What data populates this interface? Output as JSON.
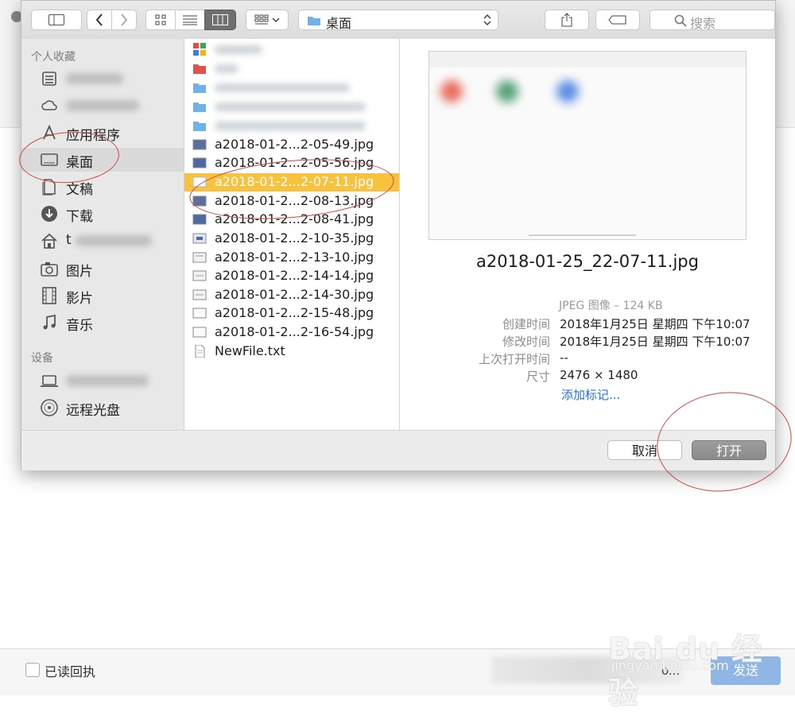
{
  "toolbar": {
    "location": "桌面",
    "search_placeholder": "搜索"
  },
  "sidebar": {
    "favorites_header": "个人收藏",
    "devices_header": "设备",
    "favorites": [
      {
        "label": "",
        "icon": "recents-icon"
      },
      {
        "label": "",
        "icon": "icloud-icon"
      },
      {
        "label": "应用程序",
        "icon": "applications-icon"
      },
      {
        "label": "桌面",
        "icon": "desktop-icon",
        "selected": true
      },
      {
        "label": "文稿",
        "icon": "documents-icon"
      },
      {
        "label": "下载",
        "icon": "downloads-icon"
      },
      {
        "label": "t",
        "icon": "home-icon"
      },
      {
        "label": "图片",
        "icon": "pictures-icon"
      },
      {
        "label": "影片",
        "icon": "movies-icon"
      },
      {
        "label": "音乐",
        "icon": "music-icon"
      }
    ],
    "devices": [
      {
        "label": "",
        "icon": "laptop-icon"
      },
      {
        "label": "远程光盘",
        "icon": "remote-disc-icon"
      }
    ]
  },
  "files": [
    {
      "name": "a2018-01-2...2-05-49.jpg",
      "icon": "image-file-icon"
    },
    {
      "name": "a2018-01-2...2-05-56.jpg",
      "icon": "image-file-icon"
    },
    {
      "name": "a2018-01-2...2-07-11.jpg",
      "icon": "image-file-icon",
      "selected": true
    },
    {
      "name": "a2018-01-2...2-08-13.jpg",
      "icon": "image-file-icon"
    },
    {
      "name": "a2018-01-2...2-08-41.jpg",
      "icon": "image-file-icon"
    },
    {
      "name": "a2018-01-2...2-10-35.jpg",
      "icon": "image-file-icon"
    },
    {
      "name": "a2018-01-2...2-13-10.jpg",
      "icon": "image-file-icon"
    },
    {
      "name": "a2018-01-2...2-14-14.jpg",
      "icon": "image-file-icon"
    },
    {
      "name": "a2018-01-2...2-14-30.jpg",
      "icon": "image-file-icon"
    },
    {
      "name": "a2018-01-2...2-15-48.jpg",
      "icon": "image-file-icon"
    },
    {
      "name": "a2018-01-2...2-16-54.jpg",
      "icon": "image-file-icon"
    },
    {
      "name": "NewFile.txt",
      "icon": "text-file-icon"
    }
  ],
  "preview": {
    "filename": "a2018-01-25_22-07-11.jpg",
    "kind": "JPEG 图像 – 124 KB",
    "created_label": "创建时间",
    "created_value": "2018年1月25日 星期四 下午10:07",
    "modified_label": "修改时间",
    "modified_value": "2018年1月25日 星期四 下午10:07",
    "last_opened_label": "上次打开时间",
    "last_opened_value": "--",
    "dimensions_label": "尺寸",
    "dimensions_value": "2476 × 1480",
    "add_tags": "添加标记..."
  },
  "footer": {
    "cancel_label": "取消",
    "open_label": "打开"
  },
  "background": {
    "read_receipt_label": "已读回执",
    "blurred_tail": "o...",
    "send_label": "发送"
  },
  "watermark": {
    "title": "Bai du 经验",
    "url": "jingyan.baidu.com"
  },
  "colors": {
    "selection": "#f7c23e",
    "annotation_circle": "#c94848",
    "link": "#2a73d6",
    "open_button": "#8a8a8a"
  }
}
